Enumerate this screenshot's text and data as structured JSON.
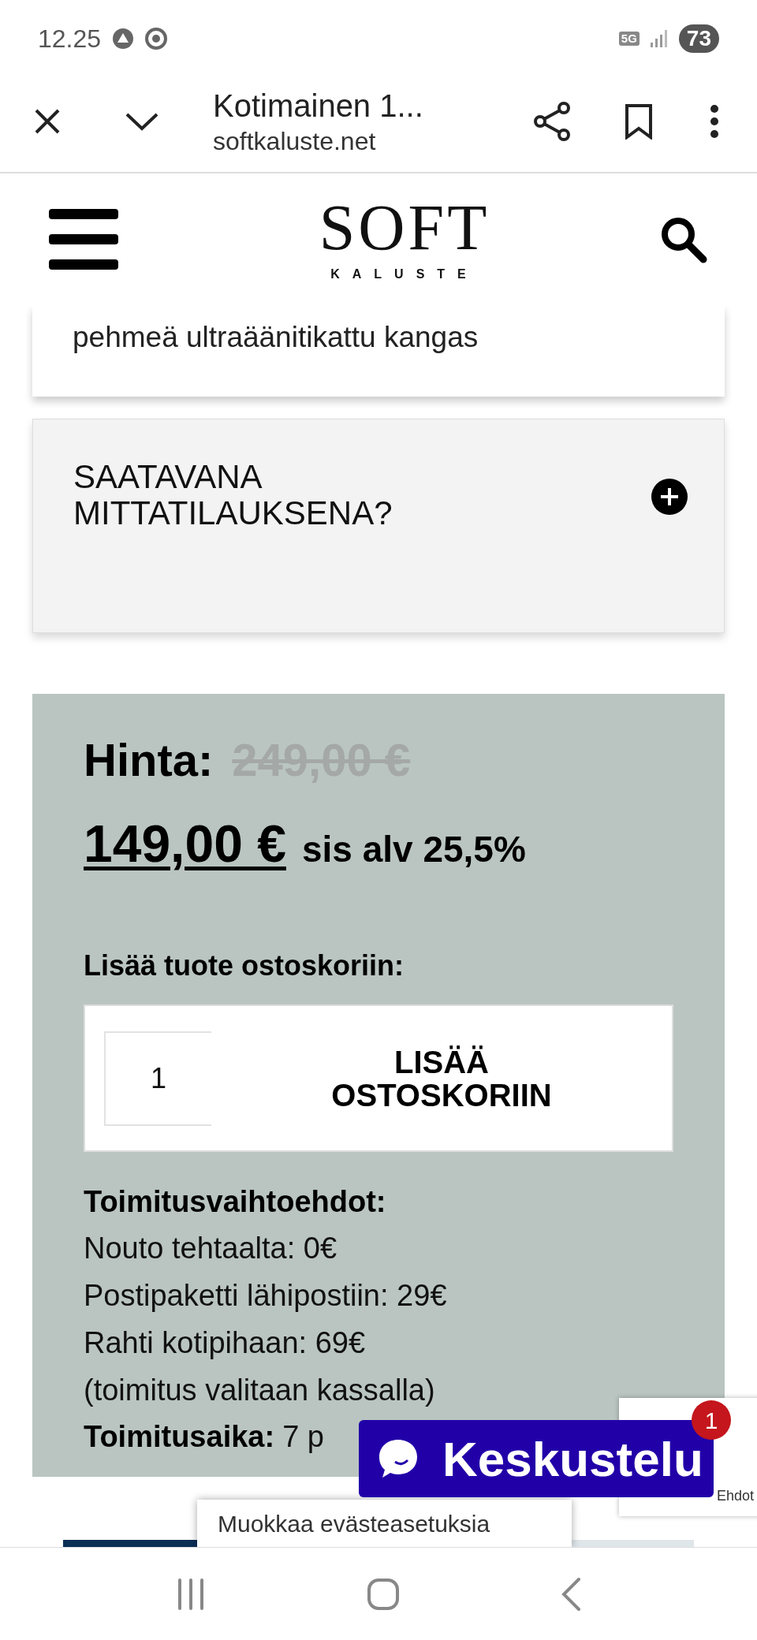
{
  "status_bar": {
    "time": "12.25",
    "network": "5G",
    "battery": "73"
  },
  "browser_bar": {
    "title": "Kotimainen 1...",
    "url": "softkaluste.net"
  },
  "site_header": {
    "logo": {
      "word": "SOFT",
      "subword": "KALUSTE"
    }
  },
  "feature_card": {
    "text": "pehmeä ultraäänitikattu kangas"
  },
  "accordion": {
    "title": "SAATAVANA MITTATILAUKSENA?",
    "expanded": false
  },
  "price_panel": {
    "label": "Hinta:",
    "old_price": "249,00 €",
    "price": "149,00 €",
    "tax_note": "sis alv 25,5%",
    "add_label": "Lisää tuote ostoskoriin:",
    "quantity": "1",
    "add_button": "LISÄÄ OSTOSKORIIN",
    "delivery_title": "Toimitusvaihtoehdot:",
    "delivery_lines": [
      "Nouto tehtaalta: 0€",
      "Postipaketti lähipostiin: 29€",
      "Rahti kotipihaan: 69€",
      "(toimitus valitaan kassalla)"
    ],
    "delivery_time_label": "Toimitusaika:",
    "delivery_time_value": "7 p"
  },
  "chat_button": {
    "label": "Keskustelu",
    "badge": "1"
  },
  "recaptcha": {
    "text": "Ehdot"
  },
  "cookie_button": {
    "label": "Muokkaa evästeasetuksia"
  }
}
